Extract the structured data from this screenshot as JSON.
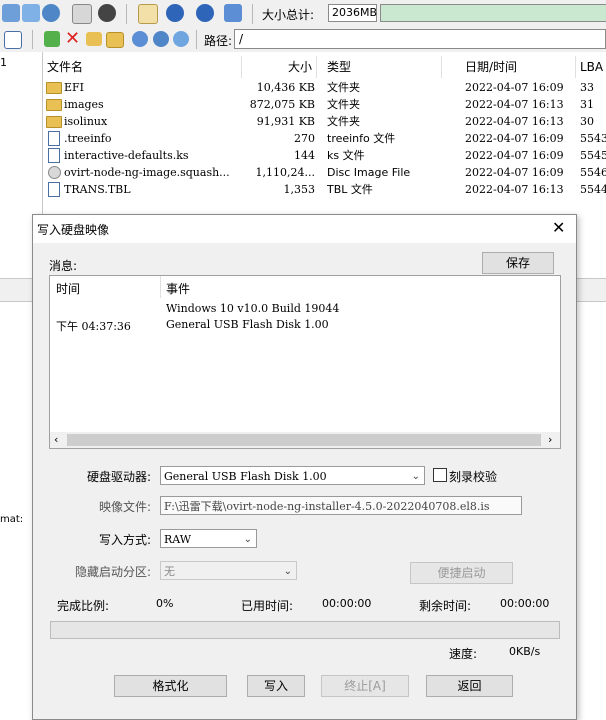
{
  "toolbar": {
    "size_total_label": "大小总计:",
    "size_total_value": "2036MB",
    "path_label": "路径:",
    "path_value": "/"
  },
  "filelist": {
    "columns": [
      "文件名",
      "大小",
      "类型",
      "日期/时间",
      "LBA"
    ],
    "rows": [
      {
        "name": "EFI",
        "size": "10,436 KB",
        "type": "文件夹",
        "date": "2022-04-07 16:09",
        "lba": "33",
        "icon": "folder-icon"
      },
      {
        "name": "images",
        "size": "872,075 KB",
        "type": "文件夹",
        "date": "2022-04-07 16:13",
        "lba": "31",
        "icon": "folder-icon"
      },
      {
        "name": "isolinux",
        "size": "91,931 KB",
        "type": "文件夹",
        "date": "2022-04-07 16:13",
        "lba": "30",
        "icon": "folder-icon"
      },
      {
        "name": ".treeinfo",
        "size": "270",
        "type": "treeinfo 文件",
        "date": "2022-04-07 16:09",
        "lba": "5543",
        "icon": "file-icon"
      },
      {
        "name": "interactive-defaults.ks",
        "size": "144",
        "type": "ks 文件",
        "date": "2022-04-07 16:09",
        "lba": "5545",
        "icon": "file-icon"
      },
      {
        "name": "ovirt-node-ng-image.squash...",
        "size": "1,110,24...",
        "type": "Disc Image File",
        "date": "2022-04-07 16:09",
        "lba": "5546",
        "icon": "disk-image-icon"
      },
      {
        "name": "TRANS.TBL",
        "size": "1,353",
        "type": "TBL 文件",
        "date": "2022-04-07 16:13",
        "lba": "5544",
        "icon": "file-icon"
      }
    ]
  },
  "left_fragments": {
    "top": "1",
    "middle": "mat:"
  },
  "dialog": {
    "title": "写入硬盘映像",
    "messages_label": "消息:",
    "save_label": "保存",
    "log_columns": [
      "时间",
      "事件"
    ],
    "log_rows": [
      {
        "time": "",
        "event": "Windows 10 v10.0 Build 19044"
      },
      {
        "time": "下午 04:37:36",
        "event": "General USB Flash Disk  1.00"
      }
    ],
    "drive_label": "硬盘驱动器:",
    "drive_value": "General USB Flash Disk  1.00",
    "verify_label": "刻录校验",
    "verify_checked": false,
    "image_label": "映像文件:",
    "image_value": "F:\\迅雷下载\\ovirt-node-ng-installer-4.5.0-2022040708.el8.is",
    "write_mode_label": "写入方式:",
    "write_mode_value": "RAW",
    "hidden_partition_label": "隐藏启动分区:",
    "hidden_partition_value": "无",
    "quick_boot_label": "便捷启动",
    "completion_label": "完成比例:",
    "completion_value": "0%",
    "elapsed_label": "已用时间:",
    "elapsed_value": "00:00:00",
    "remaining_label": "剩余时间:",
    "remaining_value": "00:00:00",
    "progress": 0,
    "speed_label": "速度:",
    "speed_value": "0KB/s",
    "buttons": {
      "format": "格式化",
      "write": "写入",
      "abort": "终止[A]",
      "back": "返回"
    }
  }
}
